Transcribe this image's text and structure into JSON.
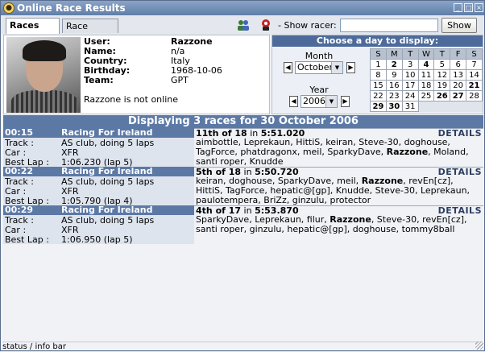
{
  "window": {
    "title": "Online Race Results",
    "buttons": [
      "_",
      "□",
      "×"
    ]
  },
  "tabs": [
    {
      "label": "Races list",
      "active": true
    },
    {
      "label": "Race details",
      "active": false
    }
  ],
  "toolbar": {
    "show_racer_label": "- Show racer:",
    "search_value": "",
    "show_button": "Show",
    "icons": [
      "users-icon",
      "racer-flag-icon"
    ]
  },
  "user": {
    "labels": {
      "user": "User:",
      "name": "Name:",
      "country": "Country:",
      "birthday": "Birthday:",
      "team": "Team:"
    },
    "values": {
      "user": "Razzone",
      "name": "n/a",
      "country": "Italy",
      "birthday": "1968-10-06",
      "team": "GPT"
    },
    "status_text": "Razzone is not online"
  },
  "day_chooser": {
    "header": "Choose a day to display:",
    "month_label": "Month",
    "month_value": "October",
    "year_label": "Year",
    "year_value": "2006",
    "weekdays": [
      "S",
      "M",
      "T",
      "W",
      "T",
      "F",
      "S"
    ],
    "weeks": [
      [
        {
          "d": "1",
          "b": false
        },
        {
          "d": "2",
          "b": true
        },
        {
          "d": "3",
          "b": false
        },
        {
          "d": "4",
          "b": true
        },
        {
          "d": "5",
          "b": false
        },
        {
          "d": "6",
          "b": false
        },
        {
          "d": "7",
          "b": false
        }
      ],
      [
        {
          "d": "8",
          "b": false
        },
        {
          "d": "9",
          "b": false
        },
        {
          "d": "10",
          "b": false
        },
        {
          "d": "11",
          "b": false
        },
        {
          "d": "12",
          "b": false
        },
        {
          "d": "13",
          "b": false
        },
        {
          "d": "14",
          "b": false
        }
      ],
      [
        {
          "d": "15",
          "b": false
        },
        {
          "d": "16",
          "b": false
        },
        {
          "d": "17",
          "b": false
        },
        {
          "d": "18",
          "b": false
        },
        {
          "d": "19",
          "b": false
        },
        {
          "d": "20",
          "b": false
        },
        {
          "d": "21",
          "b": true
        }
      ],
      [
        {
          "d": "22",
          "b": false
        },
        {
          "d": "23",
          "b": false
        },
        {
          "d": "24",
          "b": false
        },
        {
          "d": "25",
          "b": false
        },
        {
          "d": "26",
          "b": true
        },
        {
          "d": "27",
          "b": true
        },
        {
          "d": "28",
          "b": false
        }
      ],
      [
        {
          "d": "29",
          "b": true
        },
        {
          "d": "30",
          "b": true
        },
        {
          "d": "31",
          "b": false
        },
        {
          "d": "",
          "b": false
        },
        {
          "d": "",
          "b": false
        },
        {
          "d": "",
          "b": false
        },
        {
          "d": "",
          "b": false
        }
      ]
    ]
  },
  "banner": "Displaying 3 races for 30 October 2006",
  "race_labels": {
    "track": "Track :",
    "car": "Car :",
    "best_lap": "Best Lap :",
    "details": "DETAILS"
  },
  "races": [
    {
      "time": "00:15",
      "name": "Racing For Ireland",
      "track": "AS club, doing 5 laps",
      "car": "XFR",
      "best_lap": "1:06.230 (lap 5)",
      "position": "11th of 18",
      "in_text": " in ",
      "race_time": "5:51.020",
      "players_before": "aimbottle, Leprekaun, HittiS, keiran, Steve-30, doghouse, TagForce, phatdragonx, meil, SparkyDave, ",
      "highlight": "Razzone",
      "players_after": ", Moland, santi roper, Knudde"
    },
    {
      "time": "00:22",
      "name": "Racing For Ireland",
      "track": "AS club, doing 5 laps",
      "car": "XFR",
      "best_lap": "1:05.790 (lap 4)",
      "position": "5th of 18",
      "in_text": " in ",
      "race_time": "5:50.720",
      "players_before": "keiran, doghouse, SparkyDave, meil, ",
      "highlight": "Razzone",
      "players_after": ", revEn[cz], HittiS, TagForce, hepatic@[gp], Knudde, Steve-30, Leprekaun, paulotempera, BriZz, ginzulu, protector"
    },
    {
      "time": "00:29",
      "name": "Racing For Ireland",
      "track": "AS club, doing 5 laps",
      "car": "XFR",
      "best_lap": "1:06.950 (lap 5)",
      "position": "4th of 17",
      "in_text": " in ",
      "race_time": "5:53.870",
      "players_before": "SparkyDave, Leprekaun, filur, ",
      "highlight": "Razzone",
      "players_after": ", Steve-30, revEn[cz], santi roper, ginzulu, hepatic@[gp], doghouse, tommy8ball"
    }
  ],
  "status_bar": "status / info bar"
}
